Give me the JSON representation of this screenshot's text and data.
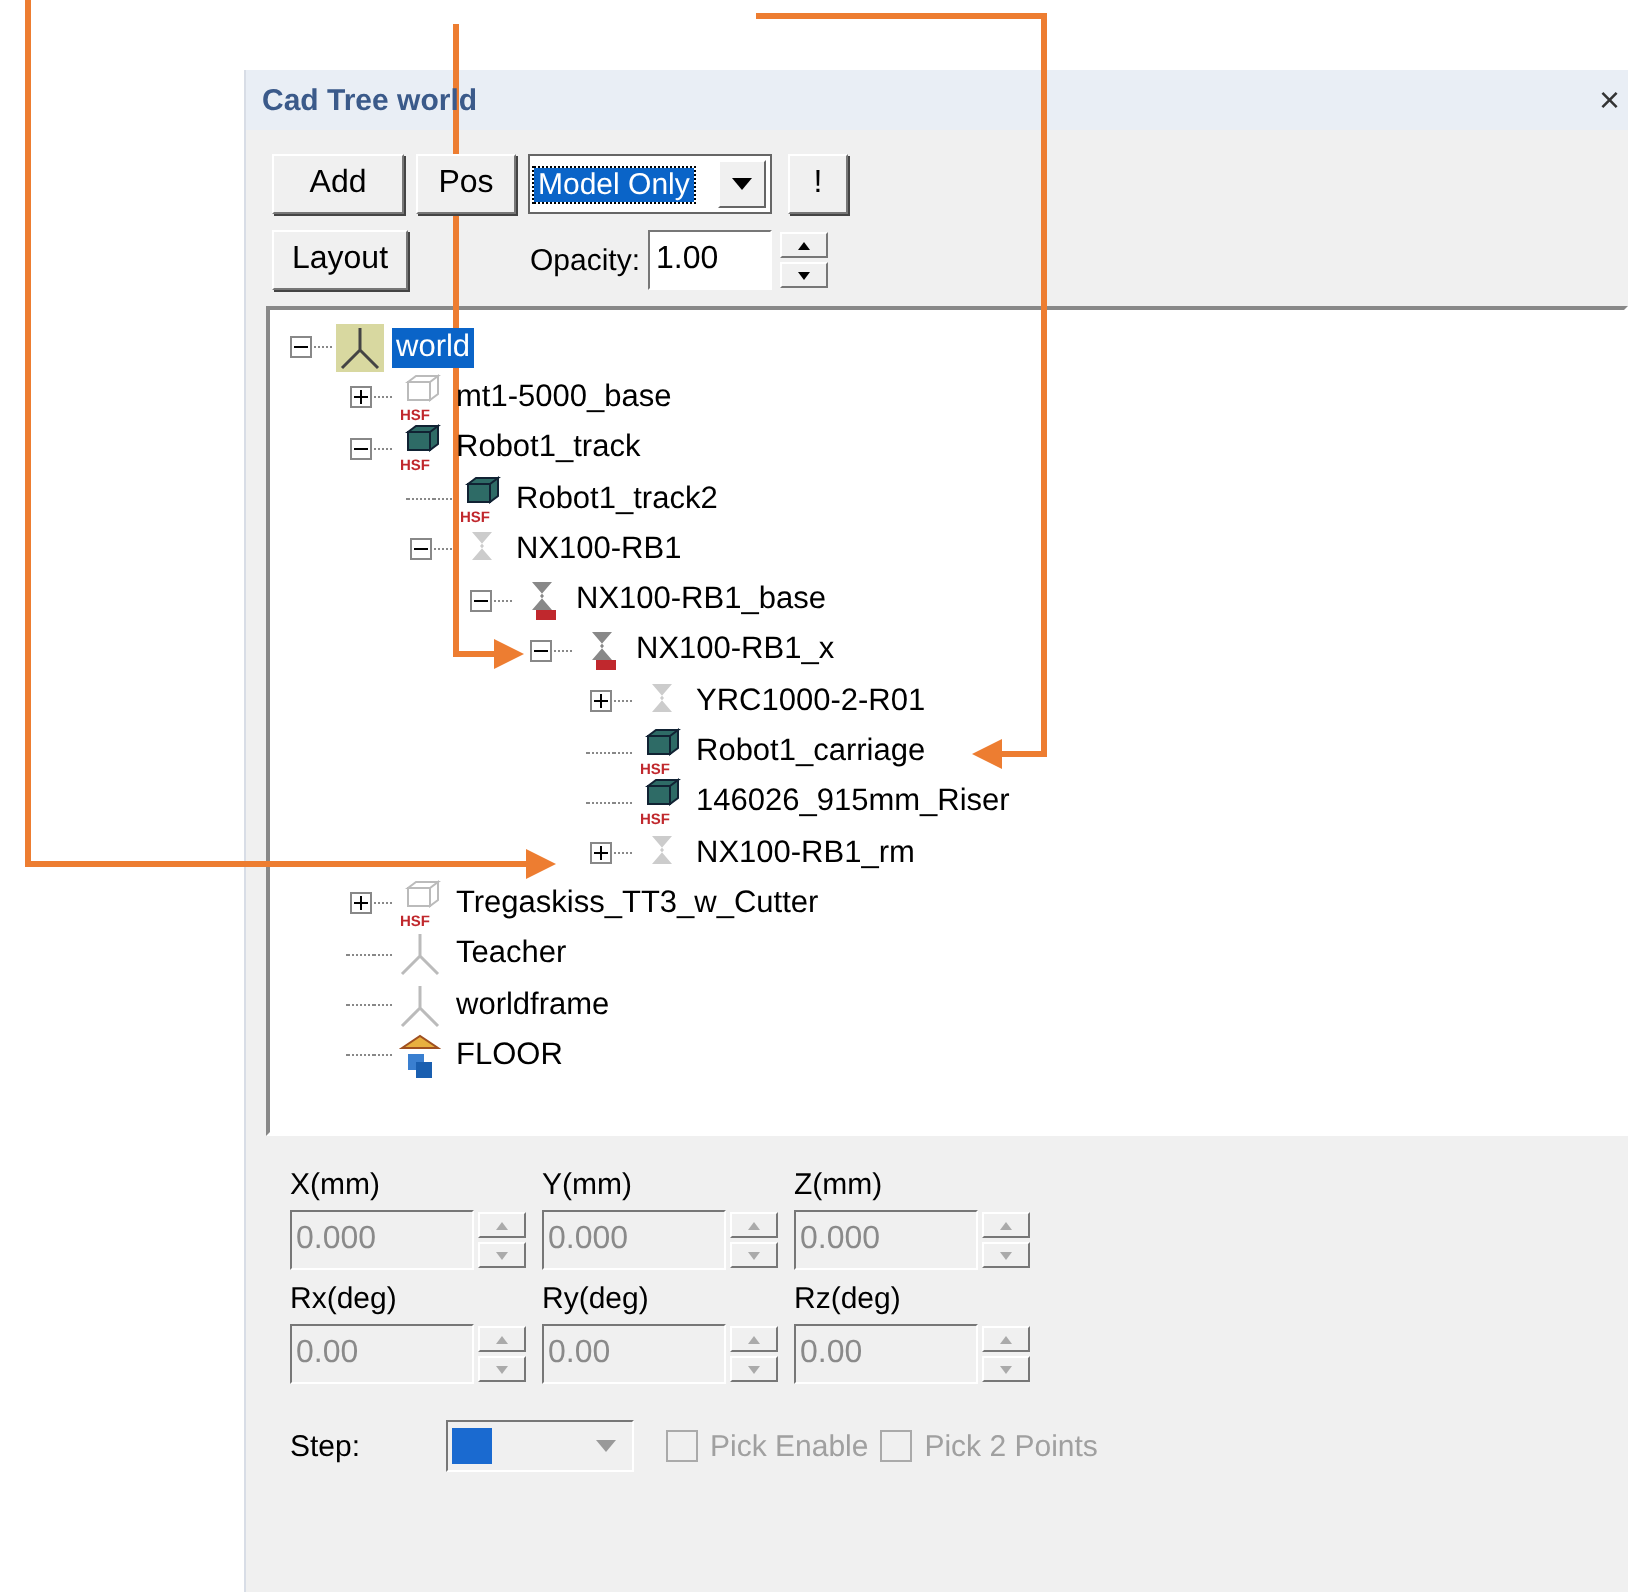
{
  "window": {
    "title": "Cad Tree world",
    "close": "×"
  },
  "toolbar": {
    "buttons": [
      "Add",
      "Pos"
    ],
    "mode": {
      "value": "Model Only",
      "selected": true
    },
    "apply": "!",
    "layout": "Layout",
    "opacity_label": "Opacity:",
    "opacity": "1.00"
  },
  "tree": [
    {
      "label": "world",
      "kind": "axes-hatched",
      "expandable": true,
      "expanded": true,
      "selected": true,
      "children": [
        {
          "label": "mt1-5000_base",
          "kind": "part-outline",
          "badge": "HSF",
          "expandable": true,
          "expanded": false,
          "selected": false
        },
        {
          "label": "Robot1_track",
          "kind": "part-solid",
          "badge": "HSF",
          "expandable": true,
          "expanded": true,
          "selected": false,
          "children": [
            {
              "label": "Robot1_track2",
              "kind": "part-solid",
              "badge": "HSF",
              "expandable": false,
              "expanded": false,
              "selected": false
            },
            {
              "label": "NX100-RB1",
              "kind": "robot-grey",
              "expandable": true,
              "expanded": true,
              "selected": false,
              "children": [
                {
                  "label": "NX100-RB1_base",
                  "kind": "robot-red",
                  "expandable": true,
                  "expanded": true,
                  "selected": false,
                  "children": [
                    {
                      "label": "NX100-RB1_x",
                      "kind": "robot-red",
                      "expandable": true,
                      "expanded": true,
                      "selected": false,
                      "children": [
                        {
                          "label": "YRC1000-2-R01",
                          "kind": "robot-grey",
                          "expandable": true,
                          "expanded": false,
                          "selected": false
                        },
                        {
                          "label": "Robot1_carriage",
                          "kind": "part-solid",
                          "badge": "HSF",
                          "expandable": false,
                          "expanded": false,
                          "selected": false
                        },
                        {
                          "label": "146026_915mm_Riser",
                          "kind": "part-solid",
                          "badge": "HSF",
                          "expandable": false,
                          "expanded": false,
                          "selected": false
                        },
                        {
                          "label": "NX100-RB1_rm",
                          "kind": "robot-grey",
                          "expandable": true,
                          "expanded": false,
                          "selected": false
                        }
                      ]
                    }
                  ]
                }
              ]
            }
          ]
        },
        {
          "label": "Tregaskiss_TT3_w_Cutter",
          "kind": "part-outline",
          "badge": "HSF",
          "expandable": true,
          "expanded": false,
          "selected": false
        },
        {
          "label": "Teacher",
          "kind": "axes",
          "expandable": false,
          "expanded": false,
          "selected": false
        },
        {
          "label": "worldframe",
          "kind": "axes",
          "expandable": false,
          "expanded": false,
          "selected": false
        },
        {
          "label": "FLOOR",
          "kind": "floor",
          "expandable": false,
          "expanded": false,
          "selected": false
        }
      ]
    }
  ],
  "position": [
    {
      "label": "X(mm)",
      "value": "0.000",
      "disabled": true
    },
    {
      "label": "Y(mm)",
      "value": "0.000",
      "disabled": true
    },
    {
      "label": "Z(mm)",
      "value": "0.000",
      "disabled": true
    },
    {
      "label": "Rx(deg)",
      "value": "0.00",
      "disabled": true
    },
    {
      "label": "Ry(deg)",
      "value": "0.00",
      "disabled": true
    },
    {
      "label": "Rz(deg)",
      "value": "0.00",
      "disabled": true
    }
  ],
  "step": {
    "label": "Step:",
    "selected": true
  },
  "checkboxes": [
    {
      "label": "Pick Enable",
      "checked": false,
      "disabled": true
    },
    {
      "label": "Pick 2 Points",
      "checked": false,
      "disabled": true
    }
  ]
}
